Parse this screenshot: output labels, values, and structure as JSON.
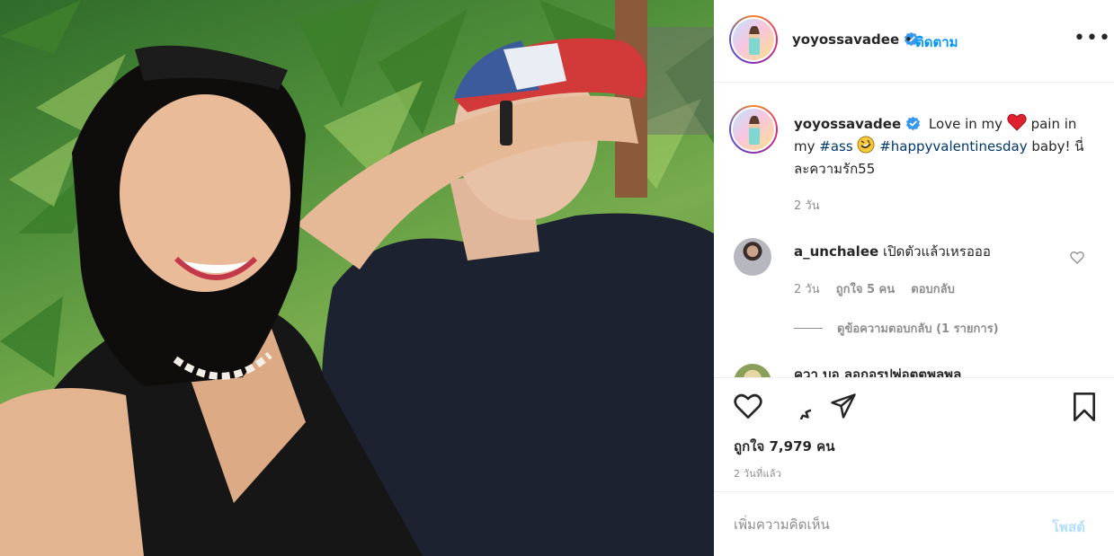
{
  "colors": {
    "accent": "#0095f6",
    "text": "#262626",
    "muted": "#8e8e8e",
    "hashtag": "#00376b",
    "post_disabled": "#b2dffc",
    "heart": "#ed4956"
  },
  "post": {
    "image_icon": "photo"
  },
  "header": {
    "username": "yoyossavadee",
    "separator": "•",
    "follow_label": "ติดตาม",
    "more_label": "•••"
  },
  "caption": {
    "username": "yoyossavadee",
    "text_1": "Love in my",
    "text_2": "pain in my",
    "hashtag_1": "#ass",
    "hashtag_2": "#happyvalentinesday",
    "text_3": "baby! นี่ละความรัก55",
    "time": "2 วัน"
  },
  "comments": [
    {
      "username": "a_unchalee",
      "text": "เปิดตัวแล้วเหรอออ",
      "time": "2 วัน",
      "likes": "ถูกใจ 5 คน",
      "reply_label": "ตอบกลับ",
      "view_replies": "ดูข้อความตอบกลับ (1 รายการ)"
    },
    {
      "text": "ควา บอ ลอกอรูปพ่อตตพลพล"
    }
  ],
  "actions": {
    "likes_text": "ถูกใจ 7,979 คน",
    "posted_ago": "2 วันที่แล้ว"
  },
  "comment_box": {
    "placeholder": "เพิ่มความคิดเห็น",
    "post_label": "โพสต์"
  }
}
